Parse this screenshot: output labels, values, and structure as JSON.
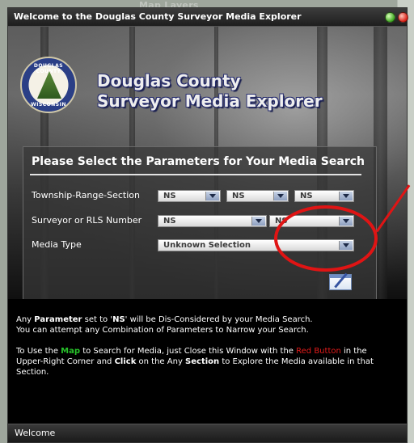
{
  "background": {
    "map_layers_label": "Map Layers"
  },
  "window": {
    "title": "Welcome to the Douglas County Surveyor Media Explorer",
    "status": "Welcome"
  },
  "header": {
    "seal": {
      "top_text": "DOUGLAS COUNTY",
      "bottom_text": "WISCONSIN"
    },
    "title_line1": "Douglas County",
    "title_line2": "Surveyor Media Explorer"
  },
  "panel": {
    "title": "Please Select the Parameters for Your Media Search",
    "rows": [
      {
        "label": "Township-Range-Section",
        "values": [
          "NS",
          "NS",
          "NS"
        ]
      },
      {
        "label": "Surveyor or RLS Number",
        "values": [
          "NS",
          "NS"
        ]
      },
      {
        "label": "Media Type",
        "values": [
          "Unknown Selection"
        ]
      }
    ]
  },
  "info": {
    "p1": {
      "a": "Any ",
      "b": "Parameter",
      "c": " set to '",
      "d": "NS",
      "e": "' will be Dis-Considered by your Media Search.",
      "line2": "You can attempt any Combination of Parameters to Narrow your Search."
    },
    "p2": {
      "a": "To Use the ",
      "map": "Map",
      "b": " to Search for Media, just Close this Window with the ",
      "red_button": "Red Button",
      "c": " in the Upper-Right Corner and ",
      "click": "Click",
      "d": " on the Any ",
      "section": "Section",
      "e": " to Explore the Media available in that Section."
    }
  },
  "colors": {
    "accent_red": "#e01414",
    "link_green": "#27c22a",
    "brand_outline": "#2a3070"
  }
}
